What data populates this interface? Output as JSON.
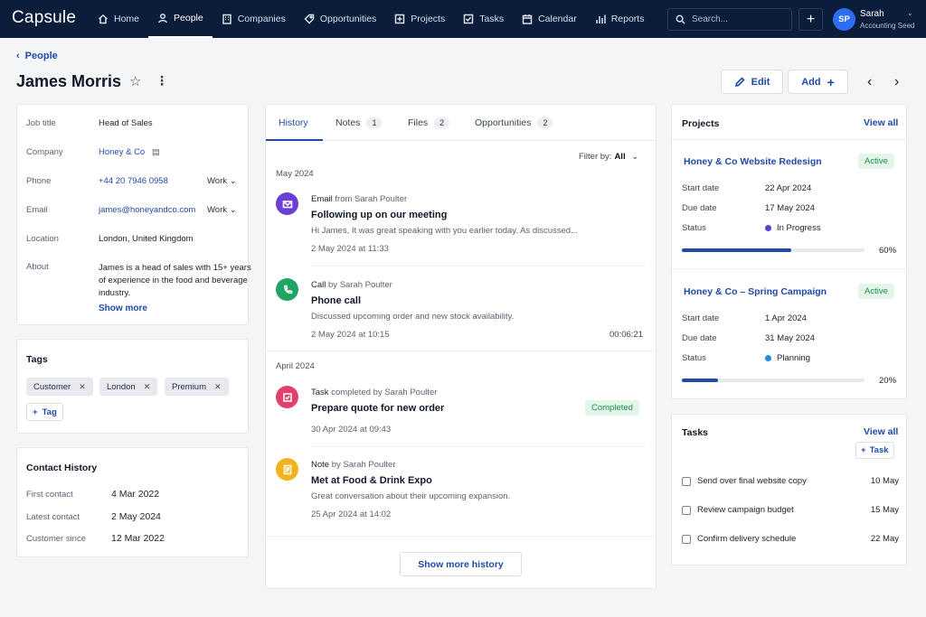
{
  "app": {
    "logo": "Capsule"
  },
  "nav": [
    {
      "label": "Home",
      "icon": "home-icon"
    },
    {
      "label": "People",
      "icon": "person-icon"
    },
    {
      "label": "Companies",
      "icon": "building-icon"
    },
    {
      "label": "Opportunities",
      "icon": "tag-icon"
    },
    {
      "label": "Projects",
      "icon": "projects-icon"
    },
    {
      "label": "Tasks",
      "icon": "tasks-icon"
    },
    {
      "label": "Calendar",
      "icon": "calendar-icon"
    },
    {
      "label": "Reports",
      "icon": "reports-icon"
    }
  ],
  "search": {
    "placeholder": "Search..."
  },
  "user": {
    "initials": "SP",
    "name": "Sarah",
    "org": "Accounting Seed"
  },
  "header": {
    "back": "People",
    "name": "James Morris",
    "edit": "Edit",
    "add": "Add"
  },
  "details": {
    "job_title_label": "Job title",
    "job_title": "Head of Sales",
    "company_label": "Company",
    "company": "Honey & Co",
    "phone_label": "Phone",
    "phone": "+44 20 7946 0958",
    "phone_type": "Work",
    "email_label": "Email",
    "email": "james@honeyandco.com",
    "email_type": "Work",
    "location_label": "Location",
    "location": "London, United Kingdom",
    "about_label": "About",
    "about": "James is a head of sales with 15+ years of experience in the food and beverage industry.",
    "show_more": "Show more"
  },
  "tags": {
    "title": "Tags",
    "items": [
      "Customer",
      "London",
      "Premium"
    ],
    "add": "Tag"
  },
  "contact_history": {
    "title": "Contact History",
    "first_label": "First contact",
    "first": "4 Mar 2022",
    "latest_label": "Latest contact",
    "latest": "2 May 2024",
    "since_label": "Customer since",
    "since": "12 Mar 2022"
  },
  "tabs": [
    {
      "label": "History",
      "count": ""
    },
    {
      "label": "Notes",
      "count": "1"
    },
    {
      "label": "Files",
      "count": "2"
    },
    {
      "label": "Opportunities",
      "count": "2"
    }
  ],
  "filter": {
    "label": "Filter by:",
    "value": "All"
  },
  "history": {
    "months": [
      "May 2024",
      "April 2024"
    ],
    "items": [
      {
        "type": "Email",
        "by": "from Sarah Poulter",
        "title": "Following up on our meeting",
        "body": "Hi James, It was great speaking with you earlier today. As discussed...",
        "date": "2 May 2024 at 11:33",
        "color": "#6b3fd1",
        "icon": "email-icon"
      },
      {
        "type": "Call",
        "by": "by Sarah Poulter",
        "title": "Phone call",
        "body": "Discussed upcoming order and new stock availability.",
        "date": "2 May 2024 at 10:15",
        "duration": "00:06:21",
        "color": "#1fa463",
        "icon": "phone-icon"
      },
      {
        "type": "Task",
        "by": "completed by Sarah Poulter",
        "title": "Prepare quote for new order",
        "date": "30 Apr 2024 at 09:43",
        "badge": "Completed",
        "color": "#e1406a",
        "icon": "task-check-icon"
      },
      {
        "type": "Note",
        "by": "by Sarah Poulter",
        "title": "Met at Food & Drink Expo",
        "body": "Great conversation about their upcoming expansion.",
        "date": "25 Apr 2024 at 14:02",
        "color": "#f2b320",
        "icon": "note-icon"
      }
    ],
    "show_more": "Show more history"
  },
  "projects": {
    "title": "Projects",
    "view_all": "View all",
    "items": [
      {
        "name": "Honey & Co Website Redesign",
        "status_badge": "Active",
        "start_label": "Start date",
        "start": "22 Apr 2024",
        "due_label": "Due date",
        "due": "17 May 2024",
        "status_label": "Status",
        "status": "In Progress",
        "status_color": "#5b3fd1",
        "progress": 60,
        "progress_text": "60%"
      },
      {
        "name": "Honey & Co – Spring Campaign",
        "status_badge": "Active",
        "start_label": "Start date",
        "start": "1 Apr 2024",
        "due_label": "Due date",
        "due": "31 May 2024",
        "status_label": "Status",
        "status": "Planning",
        "status_color": "#1f8ee0",
        "progress": 20,
        "progress_text": "20%"
      }
    ]
  },
  "tasks": {
    "title": "Tasks",
    "view_all": "View all",
    "add": "Task",
    "items": [
      {
        "label": "Send over final website copy",
        "date": "10 May"
      },
      {
        "label": "Review campaign budget",
        "date": "15 May"
      },
      {
        "label": "Confirm delivery schedule",
        "date": "22 May"
      }
    ]
  }
}
